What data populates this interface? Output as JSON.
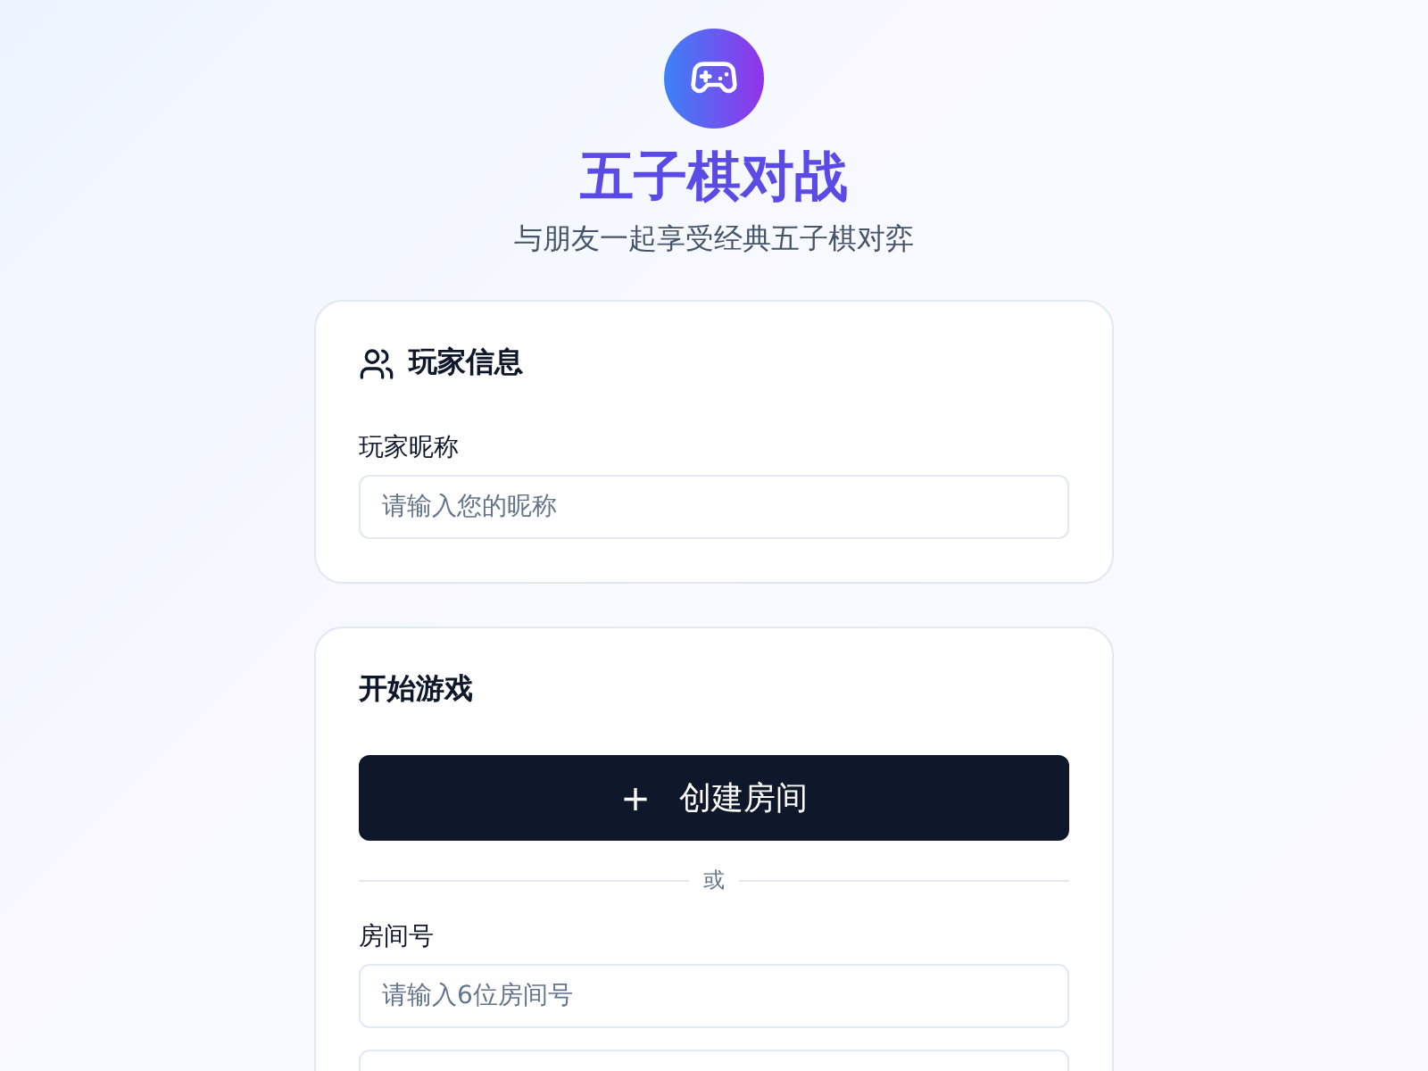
{
  "header": {
    "title": "五子棋对战",
    "subtitle": "与朋友一起享受经典五子棋对弈"
  },
  "player_card": {
    "title": "玩家信息",
    "field": {
      "label": "玩家昵称",
      "placeholder": "请输入您的昵称"
    }
  },
  "game_card": {
    "title": "开始游戏",
    "create_button": {
      "icon": "+",
      "label": "创建房间"
    },
    "divider": "或",
    "field": {
      "label": "房间号",
      "placeholder": "请输入6位房间号"
    }
  }
}
